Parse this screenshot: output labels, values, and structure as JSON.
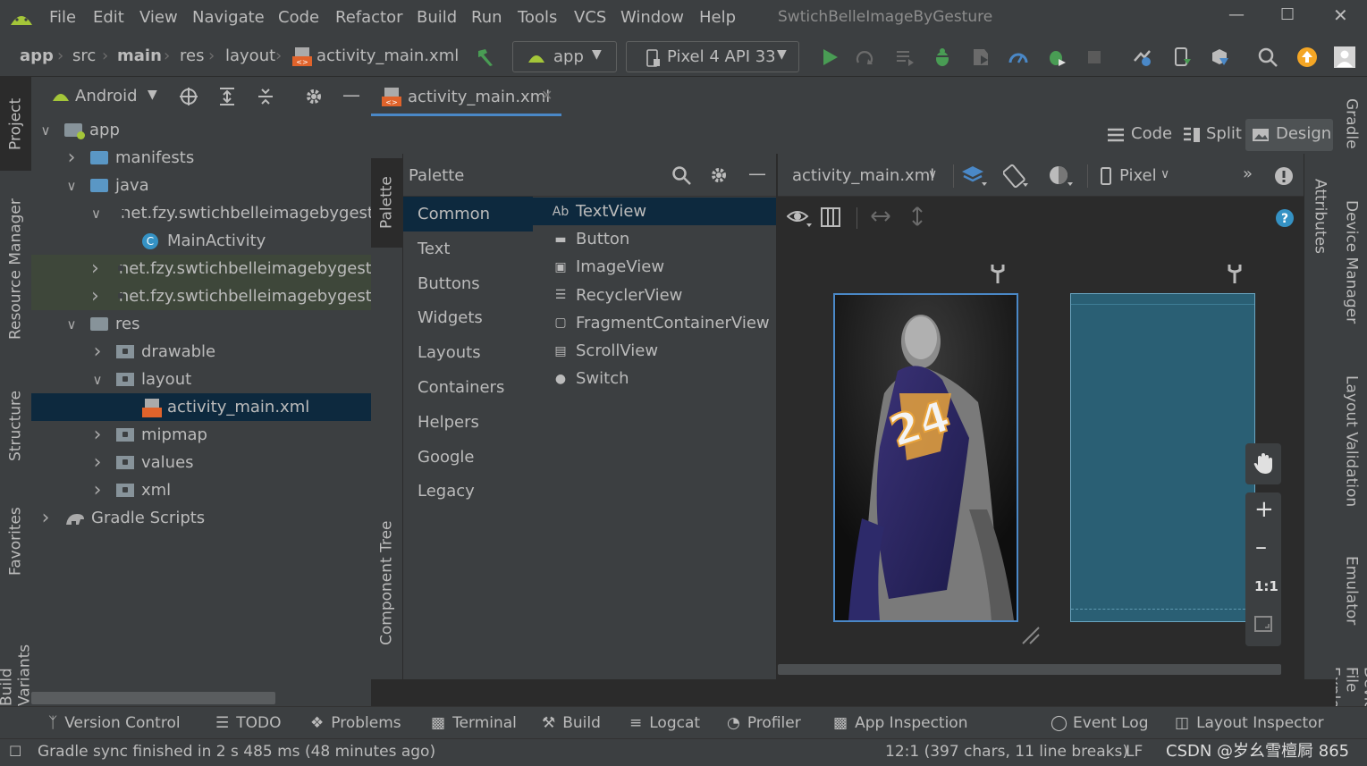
{
  "menu": {
    "items": [
      "File",
      "Edit",
      "View",
      "Navigate",
      "Code",
      "Refactor",
      "Build",
      "Run",
      "Tools",
      "VCS",
      "Window",
      "Help"
    ],
    "title": "SwtichBelleImageByGesture"
  },
  "breadcrumb": [
    "app",
    "src",
    "main",
    "res",
    "layout",
    "activity_main.xml"
  ],
  "toolbar": {
    "run_config": "app",
    "device": "Pixel 4 API 33"
  },
  "left_tabs": [
    "Project",
    "Resource Manager",
    "Structure",
    "Favorites",
    "Build Variants"
  ],
  "right_tabs": [
    "Gradle",
    "Device Manager",
    "Layout Validation",
    "Emulator",
    "Device File Explorer"
  ],
  "project": {
    "view_mode": "Android",
    "tree": [
      {
        "label": "app",
        "depth": 0,
        "arrow": "v",
        "icon": "module"
      },
      {
        "label": "manifests",
        "depth": 1,
        "arrow": ">",
        "icon": "folder-blue"
      },
      {
        "label": "java",
        "depth": 1,
        "arrow": "v",
        "icon": "folder-blue"
      },
      {
        "label": "net.fzy.swtichbelleimagebygest",
        "depth": 2,
        "arrow": "v",
        "icon": "package"
      },
      {
        "label": "MainActivity",
        "depth": 3,
        "arrow": "",
        "icon": "class"
      },
      {
        "label": "net.fzy.swtichbelleimagebygest",
        "depth": 2,
        "arrow": ">",
        "icon": "package",
        "hl": true
      },
      {
        "label": "net.fzy.swtichbelleimagebygest",
        "depth": 2,
        "arrow": ">",
        "icon": "package",
        "hl": true
      },
      {
        "label": "res",
        "depth": 1,
        "arrow": "v",
        "icon": "folder-res"
      },
      {
        "label": "drawable",
        "depth": 2,
        "arrow": ">",
        "icon": "package"
      },
      {
        "label": "layout",
        "depth": 2,
        "arrow": "v",
        "icon": "package"
      },
      {
        "label": "activity_main.xml",
        "depth": 3,
        "arrow": "",
        "icon": "xml",
        "sel": true
      },
      {
        "label": "mipmap",
        "depth": 2,
        "arrow": ">",
        "icon": "package"
      },
      {
        "label": "values",
        "depth": 2,
        "arrow": ">",
        "icon": "package"
      },
      {
        "label": "xml",
        "depth": 2,
        "arrow": ">",
        "icon": "package"
      },
      {
        "label": "Gradle Scripts",
        "depth": 0,
        "arrow": ">",
        "icon": "gradle"
      }
    ]
  },
  "editor": {
    "tab": "activity_main.xml",
    "modes": [
      "Code",
      "Split",
      "Design"
    ],
    "active_mode": "Design"
  },
  "palette": {
    "title": "Palette",
    "side_tabs": [
      "Palette",
      "Component Tree"
    ],
    "categories": [
      "Common",
      "Text",
      "Buttons",
      "Widgets",
      "Layouts",
      "Containers",
      "Helpers",
      "Google",
      "Legacy"
    ],
    "selected_category": "Common",
    "items": [
      {
        "label": "TextView",
        "icon": "Ab"
      },
      {
        "label": "Button",
        "icon": "button"
      },
      {
        "label": "ImageView",
        "icon": "image"
      },
      {
        "label": "RecyclerView",
        "icon": "list"
      },
      {
        "label": "FragmentContainerView",
        "icon": "fragment"
      },
      {
        "label": "ScrollView",
        "icon": "scroll"
      },
      {
        "label": "Switch",
        "icon": "switch"
      }
    ]
  },
  "design": {
    "file_combo": "activity_main.xml",
    "device_combo": "Pixel",
    "attributes_tab": "Attributes",
    "blueprint_color": "#2a5f74",
    "zoom": {
      "fit_label": "1:1"
    }
  },
  "bottom_tools": [
    "Version Control",
    "TODO",
    "Problems",
    "Terminal",
    "Build",
    "Logcat",
    "Profiler",
    "App Inspection",
    "Event Log",
    "Layout Inspector"
  ],
  "status": {
    "message": "Gradle sync finished in 2 s 485 ms (48 minutes ago)",
    "position": "12:1 (397 chars, 11 line breaks)",
    "line_sep": "LF",
    "watermark": "CSDN @岁幺雪檀屙 865"
  },
  "colors": {
    "accent": "#4a88c7",
    "android_green": "#a4c639",
    "run_green": "#499c54",
    "selection": "#0d293e"
  }
}
